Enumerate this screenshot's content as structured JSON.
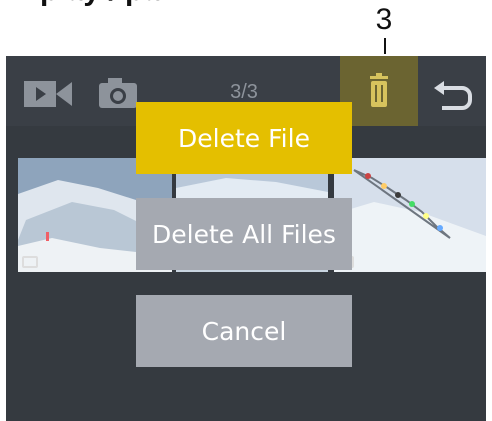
{
  "top_text": "play / pa",
  "callout_number": "3",
  "screen": {
    "page_counter": "3/3",
    "icons": [
      "video-icon",
      "camera-icon",
      "trash-icon",
      "back-icon"
    ],
    "menu": {
      "delete_file": "Delete File",
      "delete_all_files": "Delete All Files",
      "cancel": "Cancel"
    }
  },
  "colors": {
    "screen_bg": "#353a40",
    "highlight": "#e4bf00",
    "button_gray": "#a5a9b1",
    "selected_icon_bg": "#6b6431"
  }
}
